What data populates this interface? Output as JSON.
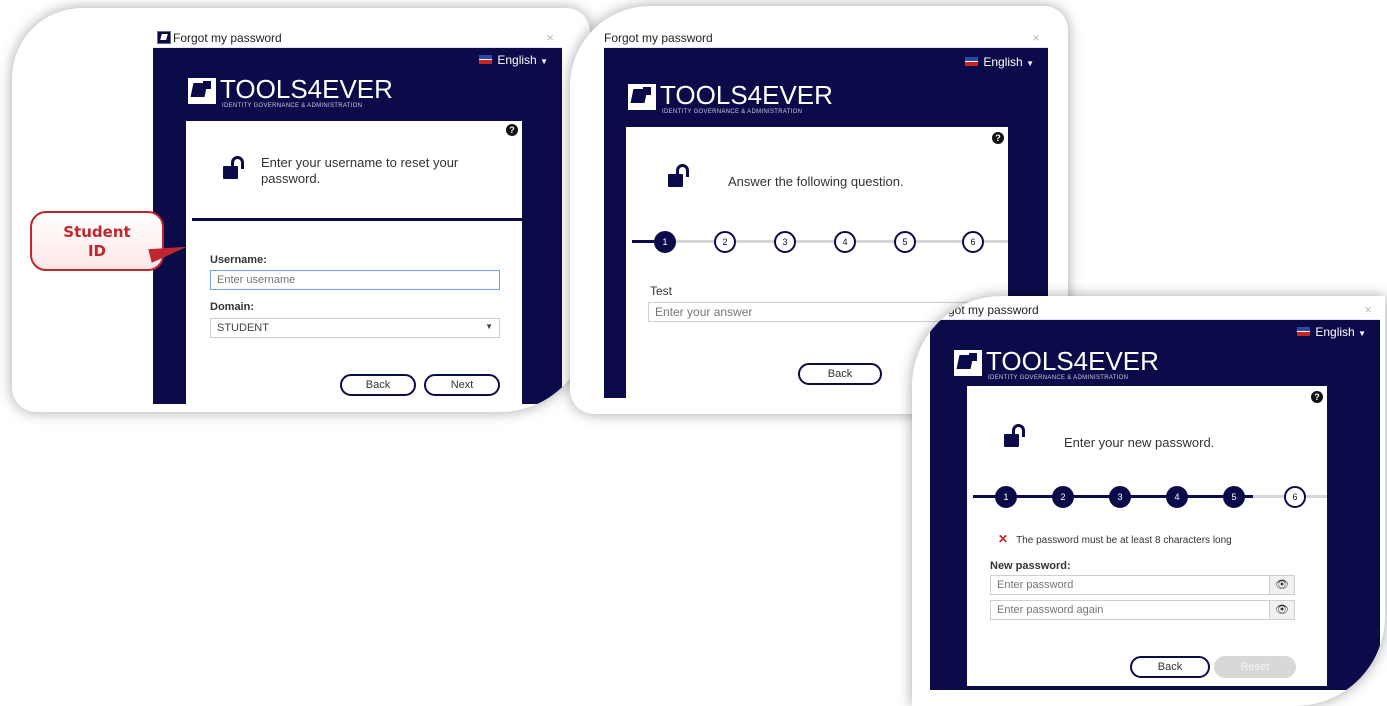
{
  "panel1": {
    "window_title": "Forgot my password",
    "close_glyph": "×",
    "language": "English",
    "brand": "TOOLS4EVER",
    "tagline": "IDENTITY GOVERNANCE & ADMINISTRATION",
    "help_glyph": "?",
    "prompt": "Enter your username to reset your password.",
    "username_label": "Username:",
    "username_placeholder": "Enter username",
    "domain_label": "Domain:",
    "domain_value": "STUDENT",
    "back_label": "Back",
    "next_label": "Next"
  },
  "callout": {
    "line1": "Student",
    "line2": "ID"
  },
  "panel2": {
    "window_title": "Forgot my password",
    "close_glyph": "×",
    "language": "English",
    "brand": "TOOLS4EVER",
    "tagline": "IDENTITY GOVERNANCE & ADMINISTRATION",
    "help_glyph": "?",
    "prompt": "Answer the following question.",
    "steps": [
      "1",
      "2",
      "3",
      "4",
      "5",
      "6"
    ],
    "current_step": 1,
    "question_label": "Test",
    "answer_placeholder": "Enter your answer",
    "back_label": "Back"
  },
  "panel3": {
    "window_title": "Forgot my password",
    "close_glyph": "×",
    "language": "English",
    "brand": "TOOLS4EVER",
    "tagline": "IDENTITY GOVERNANCE & ADMINISTRATION",
    "help_glyph": "?",
    "prompt": "Enter your new password.",
    "steps": [
      "1",
      "2",
      "3",
      "4",
      "5",
      "6"
    ],
    "current_step": 6,
    "error": "The password must be at least 8 characters long",
    "error_glyph": "✕",
    "new_password_label": "New password:",
    "password_placeholder": "Enter password",
    "password_again_placeholder": "Enter password again",
    "eye_glyph": "👁",
    "back_label": "Back",
    "reset_label": "Reset"
  },
  "colors": {
    "brand_navy": "#0b0b4a",
    "callout_red": "#c0262d",
    "error_red": "#c0262d",
    "focus_blue": "#6aa6e8"
  }
}
